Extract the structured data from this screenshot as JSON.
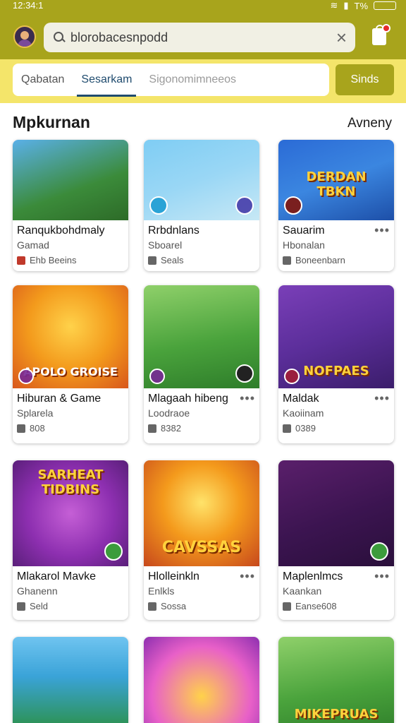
{
  "status": {
    "time": "12:34:1",
    "battery": "T%"
  },
  "search": {
    "text": "blorobacesnpodd"
  },
  "tabs": [
    {
      "label": "Qabatan",
      "active": false
    },
    {
      "label": "Sesarkam",
      "active": true
    },
    {
      "label": "Sigonomimneeos",
      "active": false
    }
  ],
  "action_button": {
    "label": "Sinds"
  },
  "section": {
    "title": "Mpkurnan",
    "link": "Avneny"
  },
  "cards": [
    {
      "title": "Ranqukbohdmaly",
      "sub": "Gamad",
      "meta": "Ehb Beeins"
    },
    {
      "title": "Rrbdnlans",
      "sub": "Sboarel",
      "meta": "Seals"
    },
    {
      "title": "Sauarim",
      "sub": "Hbonalan",
      "meta": "Boneenbarn",
      "art": "DERDAN TBKN"
    },
    {
      "title": "Hiburan & Game",
      "sub": "Splarela",
      "meta": "808",
      "art": "APOLO GROISE"
    },
    {
      "title": "Mlagaah hibeng",
      "sub": "Loodraoe",
      "meta": "8382"
    },
    {
      "title": "Maldak",
      "sub": "Kaoiinam",
      "meta": "0389",
      "art": "NOFPAES"
    },
    {
      "title": "Mlakarol Mavke",
      "sub": "Ghanenn",
      "meta": "Seld",
      "art": "SARHEAT TIDBINS"
    },
    {
      "title": "Hlolleinkln",
      "sub": "Enlkls",
      "meta": "Sossa",
      "art": "CAVSSAS"
    },
    {
      "title": "Maplenlmcs",
      "sub": "Kaankan",
      "meta": "Eanse608"
    },
    {
      "title": ""
    },
    {
      "title": ""
    },
    {
      "title": "",
      "art": "MIKEPRUAS"
    }
  ]
}
